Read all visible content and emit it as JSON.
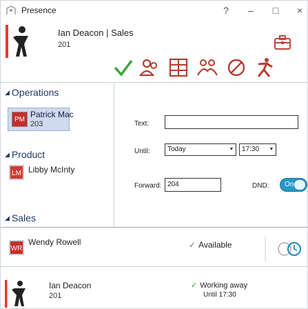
{
  "window": {
    "title": "Presence",
    "help_label": "?",
    "minimize_label": "–",
    "maximize_label": "□",
    "close_label": "×"
  },
  "me": {
    "name": "Ian Deacon | Sales",
    "extension": "201",
    "avatar_icon": "person-silhouette-icon"
  },
  "status_icons": [
    "available-check-icon",
    "team-people-icon",
    "office-building-icon",
    "people-group-icon",
    "do-not-disturb-icon",
    "running-person-icon"
  ],
  "groups": [
    {
      "label": "Operations",
      "contacts": [
        {
          "initials": "PM",
          "name": "Patrick Mac",
          "extension": "203"
        }
      ]
    },
    {
      "label": "Product",
      "contacts": [
        {
          "initials": "LM",
          "name": "Libby McInty",
          "extension": ""
        }
      ]
    },
    {
      "label": "Sales",
      "contacts": []
    }
  ],
  "form": {
    "text_label": "Text:",
    "text_value": "",
    "until_label": "Until:",
    "until_date": "Today",
    "until_time": "17:30",
    "forward_label": "Forward:",
    "forward_value": "204",
    "dnd_label": "DND:",
    "dnd_state": "On"
  },
  "bottom_list": [
    {
      "initials": "WR",
      "name": "Wendy Rowell",
      "status": "Available"
    },
    {
      "name": "Ian Deacon",
      "extension": "201",
      "status": "Working away",
      "status_sub": "Until 17:30"
    }
  ],
  "colors": {
    "accent": "#2a97c7",
    "avatar_red": "#c22f2a",
    "available_green": "#3aa838",
    "group_header": "#1f3a63"
  }
}
